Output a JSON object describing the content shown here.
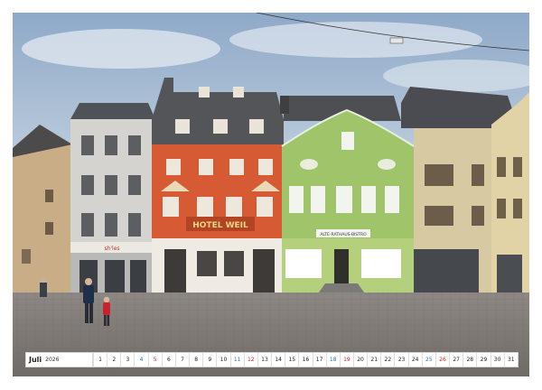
{
  "calendar": {
    "month": "Juli",
    "year": "2026",
    "days": [
      "1",
      "2",
      "3",
      "4",
      "5",
      "6",
      "7",
      "8",
      "9",
      "10",
      "11",
      "12",
      "13",
      "14",
      "15",
      "16",
      "17",
      "18",
      "19",
      "20",
      "21",
      "22",
      "23",
      "24",
      "25",
      "26",
      "27",
      "28",
      "29",
      "30",
      "31"
    ],
    "saturday_color": "#2c6fb3",
    "sunday_color": "#d11f2a"
  },
  "photo": {
    "hotel_sign": "HOTEL WEIL",
    "green_house_sign": "ALTE-RATHAUS-BISTRO",
    "shop_sign": "sh'les"
  },
  "colors": {
    "sky": "#a9bed4",
    "hotel_facade": "#d65a33",
    "green_facade": "#9fc46a",
    "cobblestone": "#8a8580"
  }
}
